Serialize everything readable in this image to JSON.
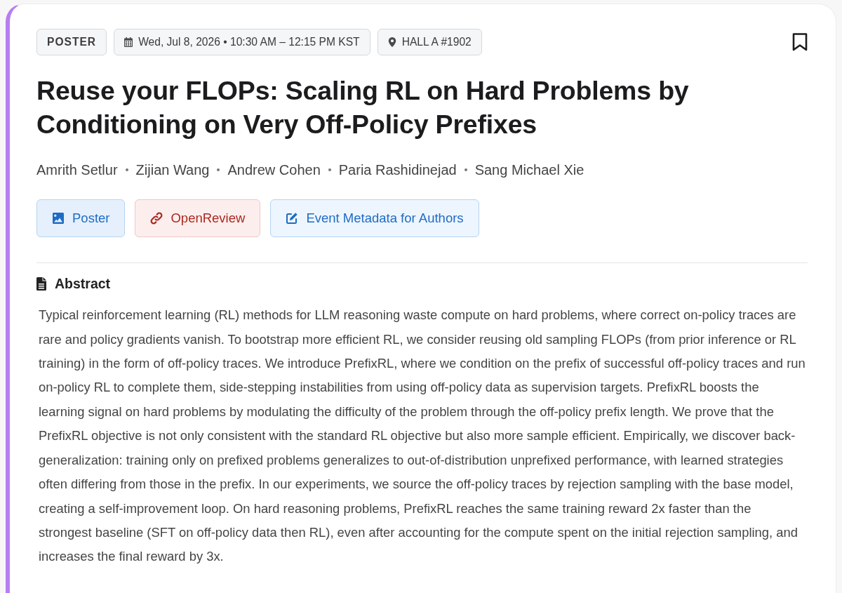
{
  "chips": [
    {
      "kind": "type",
      "label": "POSTER"
    },
    {
      "kind": "date",
      "label": "Wed, Jul 8, 2026 • 10:30 AM – 12:15 PM KST"
    },
    {
      "kind": "location",
      "label": "HALL A #1902"
    }
  ],
  "title": "Reuse your FLOPs: Scaling RL on Hard Problems by Conditioning on Very Off-Policy Prefixes",
  "authors": [
    "Amrith Setlur",
    "Zijian Wang",
    "Andrew Cohen",
    "Paria Rashidinejad",
    "Sang Michael Xie"
  ],
  "links": [
    {
      "kind": "poster",
      "label": "Poster"
    },
    {
      "kind": "openreview",
      "label": "OpenReview"
    },
    {
      "kind": "metadata",
      "label": "Event Metadata for Authors"
    }
  ],
  "abstract": {
    "heading": "Abstract",
    "text": "Typical reinforcement learning (RL) methods for LLM reasoning waste compute on hard problems, where correct on-policy traces are rare and policy gradients vanish. To bootstrap more efficient RL, we consider reusing old sampling FLOPs (from prior inference or RL training) in the form of off-policy traces. We introduce PrefixRL, where we condition on the prefix of successful off-policy traces and run on-policy RL to complete them, side-stepping instabilities from using off-policy data as supervision targets. PrefixRL boosts the learning signal on hard problems by modulating the difficulty of the problem through the off-policy prefix length. We prove that the PrefixRL objective is not only consistent with the standard RL objective but also more sample efficient. Empirically, we discover back-generalization: training only on prefixed problems generalizes to out-of-distribution unprefixed performance, with learned strategies often differing from those in the prefix. In our experiments, we source the off-policy traces by rejection sampling with the base model, creating a self-improvement loop. On hard reasoning problems, PrefixRL reaches the same training reward 2x faster than the strongest baseline (SFT on off-policy data then RL), even after accounting for the compute spent on the initial rejection sampling, and increases the final reward by 3x."
  }
}
